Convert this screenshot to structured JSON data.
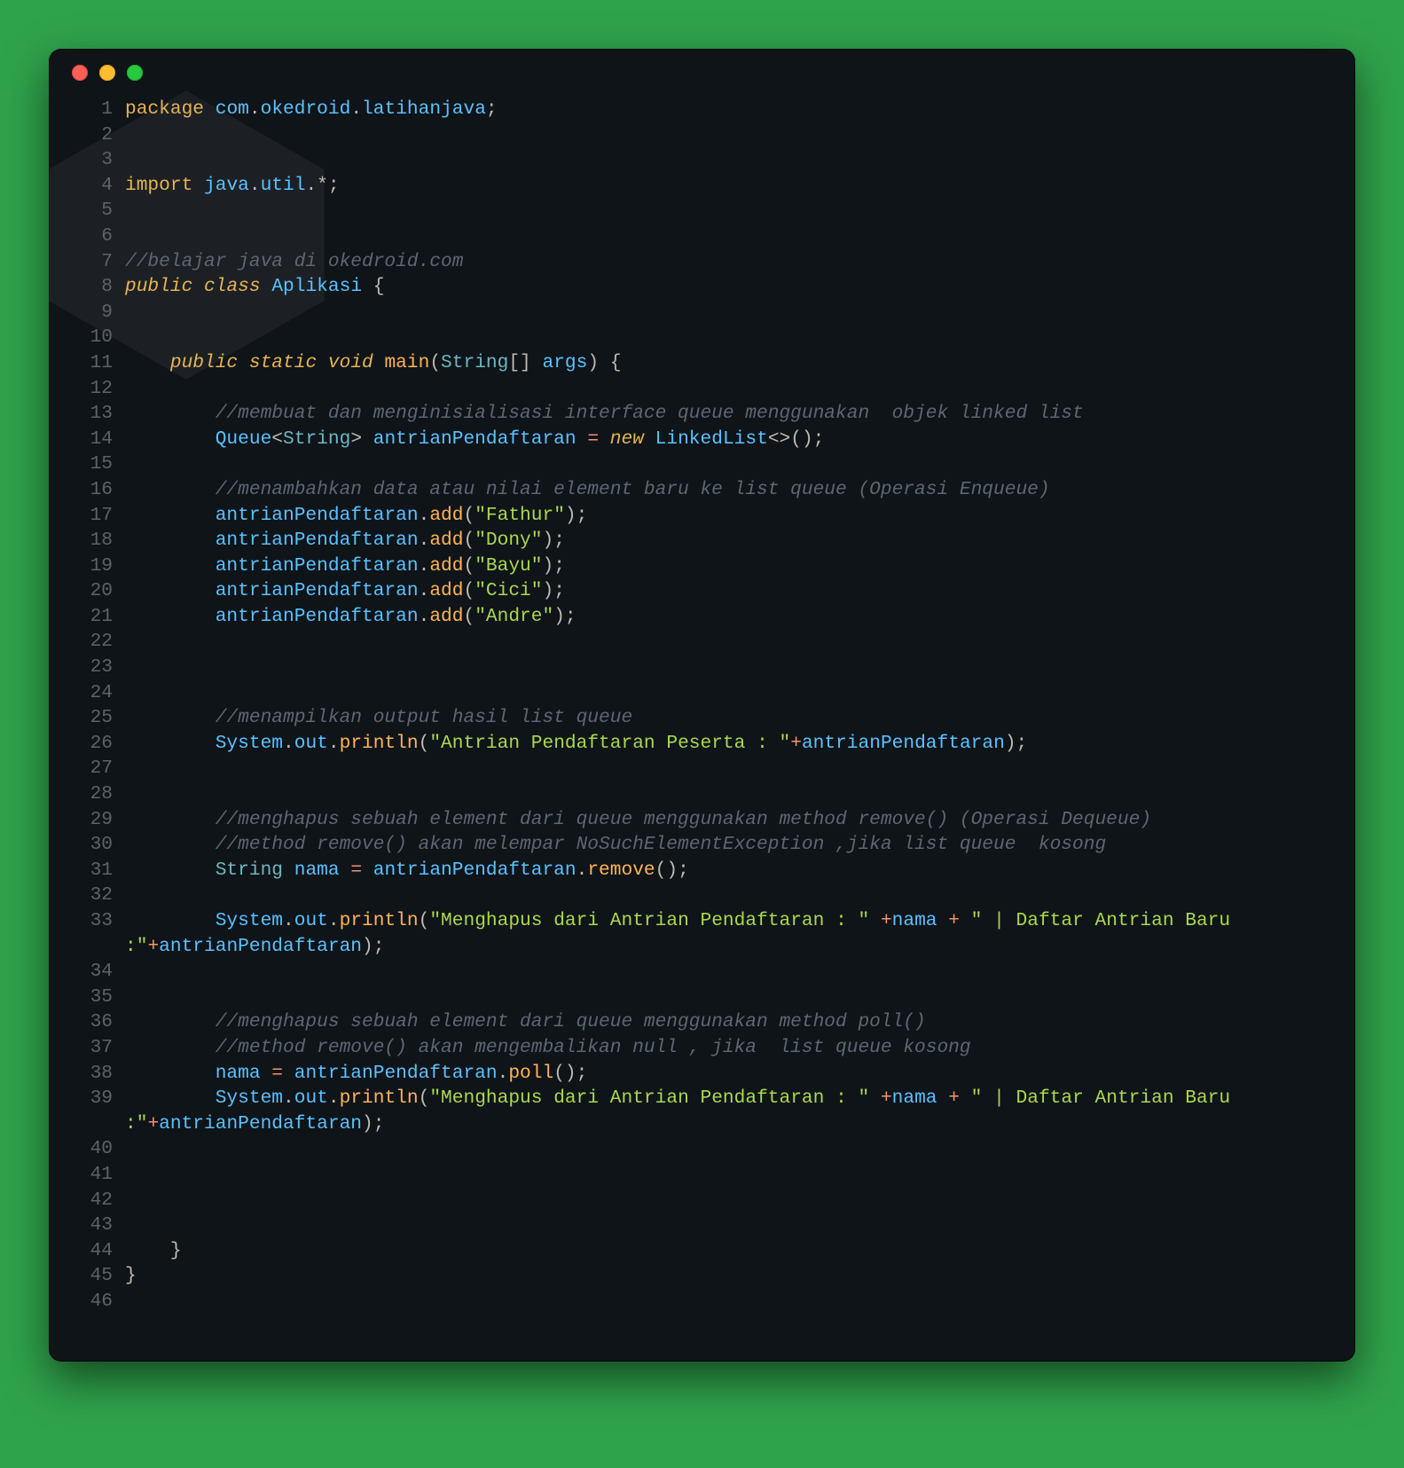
{
  "window": {
    "traffic_lights": [
      "close",
      "minimize",
      "zoom"
    ],
    "theme_colors": {
      "bg": "#0f1419",
      "outer": "#2fa34b",
      "red": "#ff5f56",
      "yellow": "#ffbd2e",
      "green": "#27c93f"
    }
  },
  "code": {
    "language": "java",
    "lines": [
      {
        "n": 1,
        "tokens": [
          [
            "k",
            "package"
          ],
          [
            "pn",
            " "
          ],
          [
            "id",
            "com"
          ],
          [
            "pn",
            "."
          ],
          [
            "id",
            "okedroid"
          ],
          [
            "pn",
            "."
          ],
          [
            "id",
            "latihanjava"
          ],
          [
            "pn",
            ";"
          ]
        ]
      },
      {
        "n": 2,
        "tokens": []
      },
      {
        "n": 3,
        "tokens": []
      },
      {
        "n": 4,
        "tokens": [
          [
            "k",
            "import"
          ],
          [
            "pn",
            " "
          ],
          [
            "id",
            "java"
          ],
          [
            "pn",
            "."
          ],
          [
            "id",
            "util"
          ],
          [
            "pn",
            ".*;"
          ]
        ]
      },
      {
        "n": 5,
        "tokens": []
      },
      {
        "n": 6,
        "tokens": []
      },
      {
        "n": 7,
        "tokens": [
          [
            "cm",
            "//belajar java di okedroid.com"
          ]
        ]
      },
      {
        "n": 8,
        "tokens": [
          [
            "kt",
            "public"
          ],
          [
            "pn",
            " "
          ],
          [
            "kt",
            "class"
          ],
          [
            "pn",
            " "
          ],
          [
            "id",
            "Aplikasi"
          ],
          [
            "pn",
            " {"
          ]
        ]
      },
      {
        "n": 9,
        "tokens": []
      },
      {
        "n": 10,
        "tokens": []
      },
      {
        "n": 11,
        "tokens": [
          [
            "pn",
            "    "
          ],
          [
            "kt",
            "public"
          ],
          [
            "pn",
            " "
          ],
          [
            "kt",
            "static"
          ],
          [
            "pn",
            " "
          ],
          [
            "kt",
            "void"
          ],
          [
            "pn",
            " "
          ],
          [
            "fn",
            "main"
          ],
          [
            "pn",
            "("
          ],
          [
            "ty",
            "String"
          ],
          [
            "pn",
            "[] "
          ],
          [
            "id",
            "args"
          ],
          [
            "pn",
            ") {"
          ]
        ]
      },
      {
        "n": 12,
        "tokens": []
      },
      {
        "n": 13,
        "tokens": [
          [
            "pn",
            "        "
          ],
          [
            "cm",
            "//membuat dan menginisialisasi interface queue menggunakan  objek linked list"
          ]
        ]
      },
      {
        "n": 14,
        "tokens": [
          [
            "pn",
            "        "
          ],
          [
            "id",
            "Queue"
          ],
          [
            "pn",
            "<"
          ],
          [
            "ty",
            "String"
          ],
          [
            "pn",
            "> "
          ],
          [
            "id",
            "antrianPendaftaran"
          ],
          [
            "pn",
            " "
          ],
          [
            "op",
            "="
          ],
          [
            "pn",
            " "
          ],
          [
            "kt",
            "new"
          ],
          [
            "pn",
            " "
          ],
          [
            "id",
            "LinkedList"
          ],
          [
            "pn",
            "<>();"
          ]
        ]
      },
      {
        "n": 15,
        "tokens": []
      },
      {
        "n": 16,
        "tokens": [
          [
            "pn",
            "        "
          ],
          [
            "cm",
            "//menambahkan data atau nilai element baru ke list queue (Operasi Enqueue)"
          ]
        ]
      },
      {
        "n": 17,
        "tokens": [
          [
            "pn",
            "        "
          ],
          [
            "id",
            "antrianPendaftaran"
          ],
          [
            "pn",
            "."
          ],
          [
            "fn",
            "add"
          ],
          [
            "pn",
            "("
          ],
          [
            "str",
            "\"Fathur\""
          ],
          [
            "pn",
            ");"
          ]
        ]
      },
      {
        "n": 18,
        "tokens": [
          [
            "pn",
            "        "
          ],
          [
            "id",
            "antrianPendaftaran"
          ],
          [
            "pn",
            "."
          ],
          [
            "fn",
            "add"
          ],
          [
            "pn",
            "("
          ],
          [
            "str",
            "\"Dony\""
          ],
          [
            "pn",
            ");"
          ]
        ]
      },
      {
        "n": 19,
        "tokens": [
          [
            "pn",
            "        "
          ],
          [
            "id",
            "antrianPendaftaran"
          ],
          [
            "pn",
            "."
          ],
          [
            "fn",
            "add"
          ],
          [
            "pn",
            "("
          ],
          [
            "str",
            "\"Bayu\""
          ],
          [
            "pn",
            ");"
          ]
        ]
      },
      {
        "n": 20,
        "tokens": [
          [
            "pn",
            "        "
          ],
          [
            "id",
            "antrianPendaftaran"
          ],
          [
            "pn",
            "."
          ],
          [
            "fn",
            "add"
          ],
          [
            "pn",
            "("
          ],
          [
            "str",
            "\"Cici\""
          ],
          [
            "pn",
            ");"
          ]
        ]
      },
      {
        "n": 21,
        "tokens": [
          [
            "pn",
            "        "
          ],
          [
            "id",
            "antrianPendaftaran"
          ],
          [
            "pn",
            "."
          ],
          [
            "fn",
            "add"
          ],
          [
            "pn",
            "("
          ],
          [
            "str",
            "\"Andre\""
          ],
          [
            "pn",
            ");"
          ]
        ]
      },
      {
        "n": 22,
        "tokens": []
      },
      {
        "n": 23,
        "tokens": []
      },
      {
        "n": 24,
        "tokens": []
      },
      {
        "n": 25,
        "tokens": [
          [
            "pn",
            "        "
          ],
          [
            "cm",
            "//menampilkan output hasil list queue"
          ]
        ]
      },
      {
        "n": 26,
        "tokens": [
          [
            "pn",
            "        "
          ],
          [
            "id",
            "System"
          ],
          [
            "pn",
            "."
          ],
          [
            "id",
            "out"
          ],
          [
            "pn",
            "."
          ],
          [
            "fn",
            "println"
          ],
          [
            "pn",
            "("
          ],
          [
            "str",
            "\"Antrian Pendaftaran Peserta : \""
          ],
          [
            "op",
            "+"
          ],
          [
            "id",
            "antrianPendaftaran"
          ],
          [
            "pn",
            ");"
          ]
        ]
      },
      {
        "n": 27,
        "tokens": []
      },
      {
        "n": 28,
        "tokens": []
      },
      {
        "n": 29,
        "tokens": [
          [
            "pn",
            "        "
          ],
          [
            "cm",
            "//menghapus sebuah element dari queue menggunakan method remove() (Operasi Dequeue)"
          ]
        ]
      },
      {
        "n": 30,
        "tokens": [
          [
            "pn",
            "        "
          ],
          [
            "cm",
            "//method remove() akan melempar NoSuchElementException ,jika list queue  kosong"
          ]
        ]
      },
      {
        "n": 31,
        "tokens": [
          [
            "pn",
            "        "
          ],
          [
            "ty",
            "String"
          ],
          [
            "pn",
            " "
          ],
          [
            "id",
            "nama"
          ],
          [
            "pn",
            " "
          ],
          [
            "op",
            "="
          ],
          [
            "pn",
            " "
          ],
          [
            "id",
            "antrianPendaftaran"
          ],
          [
            "pn",
            "."
          ],
          [
            "fn",
            "remove"
          ],
          [
            "pn",
            "();"
          ]
        ]
      },
      {
        "n": 32,
        "tokens": []
      },
      {
        "n": 33,
        "tokens": [
          [
            "pn",
            "        "
          ],
          [
            "id",
            "System"
          ],
          [
            "pn",
            "."
          ],
          [
            "id",
            "out"
          ],
          [
            "pn",
            "."
          ],
          [
            "fn",
            "println"
          ],
          [
            "pn",
            "("
          ],
          [
            "str",
            "\"Menghapus dari Antrian Pendaftaran : \""
          ],
          [
            "pn",
            " "
          ],
          [
            "op",
            "+"
          ],
          [
            "id",
            "nama"
          ],
          [
            "pn",
            " "
          ],
          [
            "op",
            "+"
          ],
          [
            "pn",
            " "
          ],
          [
            "str",
            "\" | Daftar Antrian Baru :\""
          ],
          [
            "op",
            "+"
          ],
          [
            "id",
            "antrianPendaftaran"
          ],
          [
            "pn",
            ");"
          ]
        ]
      },
      {
        "n": 34,
        "tokens": []
      },
      {
        "n": 35,
        "tokens": []
      },
      {
        "n": 36,
        "tokens": [
          [
            "pn",
            "        "
          ],
          [
            "cm",
            "//menghapus sebuah element dari queue menggunakan method poll()"
          ]
        ]
      },
      {
        "n": 37,
        "tokens": [
          [
            "pn",
            "        "
          ],
          [
            "cm",
            "//method remove() akan mengembalikan null , jika  list queue kosong"
          ]
        ]
      },
      {
        "n": 38,
        "tokens": [
          [
            "pn",
            "        "
          ],
          [
            "id",
            "nama"
          ],
          [
            "pn",
            " "
          ],
          [
            "op",
            "="
          ],
          [
            "pn",
            " "
          ],
          [
            "id",
            "antrianPendaftaran"
          ],
          [
            "pn",
            "."
          ],
          [
            "fn",
            "poll"
          ],
          [
            "pn",
            "();"
          ]
        ]
      },
      {
        "n": 39,
        "tokens": [
          [
            "pn",
            "        "
          ],
          [
            "id",
            "System"
          ],
          [
            "pn",
            "."
          ],
          [
            "id",
            "out"
          ],
          [
            "pn",
            "."
          ],
          [
            "fn",
            "println"
          ],
          [
            "pn",
            "("
          ],
          [
            "str",
            "\"Menghapus dari Antrian Pendaftaran : \""
          ],
          [
            "pn",
            " "
          ],
          [
            "op",
            "+"
          ],
          [
            "id",
            "nama"
          ],
          [
            "pn",
            " "
          ],
          [
            "op",
            "+"
          ],
          [
            "pn",
            " "
          ],
          [
            "str",
            "\" | Daftar Antrian Baru :\""
          ],
          [
            "op",
            "+"
          ],
          [
            "id",
            "antrianPendaftaran"
          ],
          [
            "pn",
            ");"
          ]
        ]
      },
      {
        "n": 40,
        "tokens": []
      },
      {
        "n": 41,
        "tokens": []
      },
      {
        "n": 42,
        "tokens": []
      },
      {
        "n": 43,
        "tokens": []
      },
      {
        "n": 44,
        "tokens": [
          [
            "pn",
            "    }"
          ]
        ]
      },
      {
        "n": 45,
        "tokens": [
          [
            "pn",
            "}"
          ]
        ]
      },
      {
        "n": 46,
        "tokens": []
      }
    ]
  }
}
